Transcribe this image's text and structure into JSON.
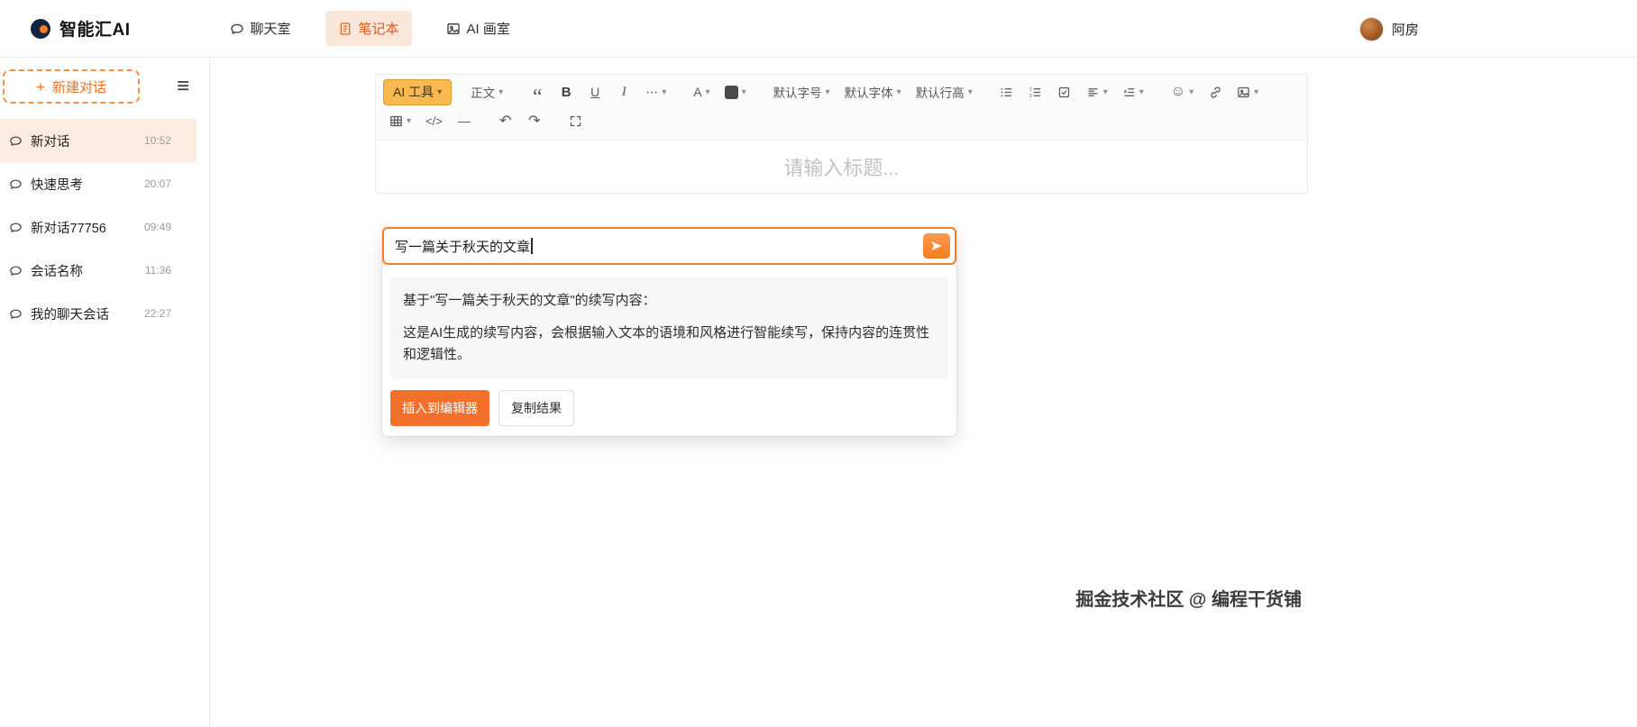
{
  "colors": {
    "accent": "#ff7d26",
    "accent_button": "#f2702c",
    "active_item_bg": "#fcebe0",
    "ai_tool_bg": "#f7b950"
  },
  "navbar": {
    "logo_text": "智能汇AI",
    "items": [
      {
        "label": "聊天室"
      },
      {
        "label": "笔记本",
        "active": true
      },
      {
        "label": "AI 画室"
      }
    ],
    "user_name": "阿房"
  },
  "sidebar": {
    "new_chat_label": "新建对话",
    "items": [
      {
        "label": "新对话",
        "time": "10:52",
        "active": true
      },
      {
        "label": "快速思考",
        "time": "20:07"
      },
      {
        "label": "新对话77756",
        "time": "09:49"
      },
      {
        "label": "会话名称",
        "time": "11:36"
      },
      {
        "label": "我的聊天会话",
        "time": "22:27"
      }
    ]
  },
  "toolbar": {
    "ai_tools": "AI 工具",
    "paragraph": "正文",
    "font_size": "默认字号",
    "font_family": "默认字体",
    "line_height": "默认行高"
  },
  "editor": {
    "title_placeholder": "请输入标题..."
  },
  "ai_panel": {
    "input_value": "写一篇关于秋天的文章",
    "result_intro": "基于\"写一篇关于秋天的文章\"的续写内容：",
    "result_body": "这是AI生成的续写内容，会根据输入文本的语境和风格进行智能续写，保持内容的连贯性和逻辑性。",
    "insert_label": "插入到编辑器",
    "copy_label": "复制结果"
  },
  "watermark": "掘金技术社区 @ 编程干货铺",
  "icons": {
    "caret": "▾",
    "quote": "“",
    "bold": "B",
    "underline": "U",
    "italic": "I",
    "more": "⋯",
    "font_color": "A",
    "code": "</>",
    "divider": "—",
    "undo": "↶",
    "redo": "↷",
    "menu_glyph": "≡",
    "plus": "+",
    "smiley": "☺"
  }
}
